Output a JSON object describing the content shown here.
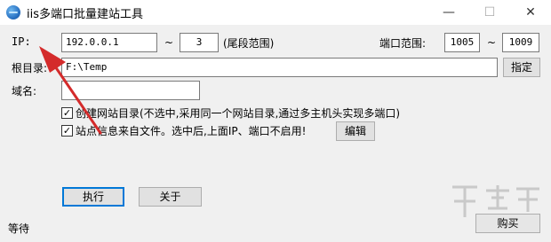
{
  "window": {
    "title": "iis多端口批量建站工具",
    "minimize": "—",
    "maximize": "☐",
    "close": "✕"
  },
  "ip": {
    "label": "IP:",
    "value": "192.0.0.1",
    "tilde": "~",
    "range_end": "3",
    "hint": "(尾段范围)"
  },
  "port": {
    "label": "端口范围:",
    "start": "1005",
    "tilde": "~",
    "end": "1009"
  },
  "root": {
    "label": "根目录:",
    "value": "F:\\Temp",
    "browse_label": "指定"
  },
  "domain": {
    "label": "域名:",
    "value": ""
  },
  "options": {
    "create_site_dir": {
      "checked": true,
      "label": "创建网站目录(不选中,采用同一个网站目录,通过多主机头实现多端口)"
    },
    "site_info_file": {
      "checked": true,
      "label": "站点信息来自文件。选中后,上面IP、端口不启用!",
      "edit_label": "编辑"
    }
  },
  "actions": {
    "run_label": "执行",
    "about_label": "关于",
    "buy_label": "购买"
  },
  "status": {
    "text": "等待"
  },
  "colors": {
    "arrow": "#d42b2b",
    "focus": "#0078d7"
  }
}
